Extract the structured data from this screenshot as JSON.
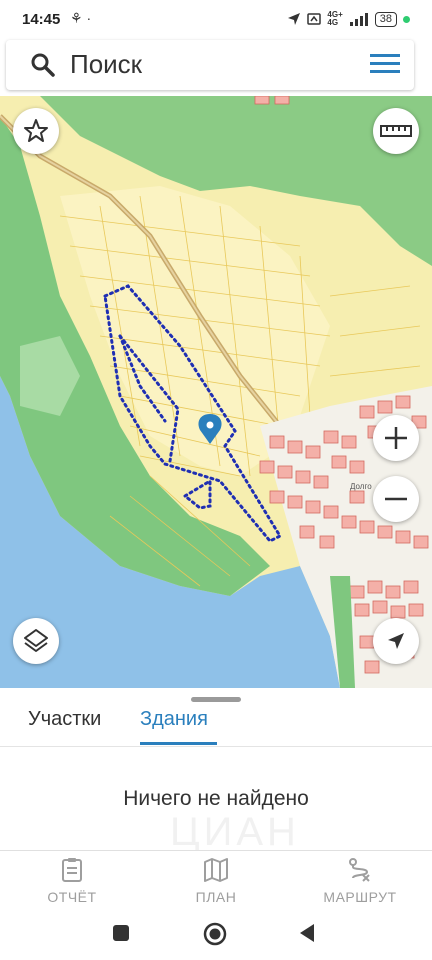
{
  "status_bar": {
    "time": "14:45",
    "extra_icons": "⍿ ·",
    "network": "4G+\n4G",
    "battery": "38"
  },
  "search": {
    "placeholder": "Поиск"
  },
  "map": {
    "street_label": "Долго"
  },
  "sheet": {
    "tabs": [
      {
        "label": "Участки",
        "active": false
      },
      {
        "label": "Здания",
        "active": true
      }
    ],
    "empty_message": "Ничего не найдено",
    "watermark": "ЦИАН"
  },
  "bottom_nav": {
    "items": [
      {
        "label": "ОТЧЁТ",
        "icon": "report-icon"
      },
      {
        "label": "ПЛАН",
        "icon": "map-icon"
      },
      {
        "label": "МАРШРУТ",
        "icon": "route-icon"
      }
    ]
  },
  "colors": {
    "accent": "#2a7fbd",
    "water": "#8fc1e8",
    "forest": "#7fc77f",
    "plot_fill": "#f6eeb0",
    "plot_border": "#e8c85a",
    "building": "#e88a80",
    "route_dots": "#1f2fb3",
    "marker": "#2a7fbd"
  }
}
